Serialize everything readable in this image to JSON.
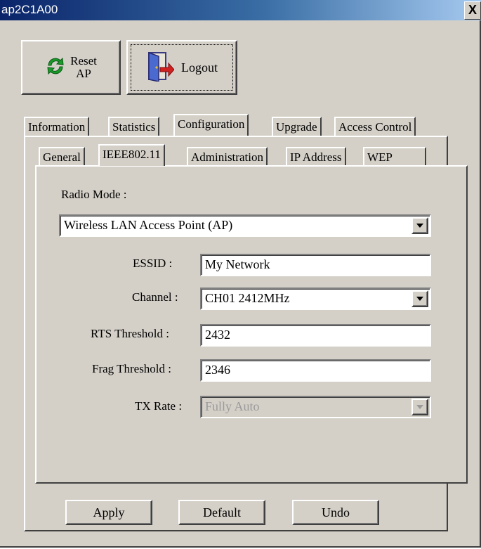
{
  "window": {
    "title": "ap2C1A00",
    "close_symbol": "X"
  },
  "toolbar": {
    "reset_label_line1": "Reset",
    "reset_label_line2": "AP",
    "logout_label": "Logout"
  },
  "main_tabs": [
    {
      "label": "Information"
    },
    {
      "label": "Statistics"
    },
    {
      "label": "Configuration",
      "active": true
    },
    {
      "label": "Upgrade"
    },
    {
      "label": "Access Control"
    }
  ],
  "sub_tabs": [
    {
      "label": "General"
    },
    {
      "label": "IEEE802.11",
      "active": true
    },
    {
      "label": "Administration"
    },
    {
      "label": "IP Address"
    },
    {
      "label": "WEP"
    }
  ],
  "form": {
    "radio_mode_label": "Radio Mode :",
    "radio_mode_value": "Wireless LAN Access Point (AP)",
    "essid_label": "ESSID :",
    "essid_value": "My Network",
    "channel_label": "Channel :",
    "channel_value": "CH01 2412MHz",
    "rts_label": "RTS Threshold :",
    "rts_value": "2432",
    "frag_label": "Frag Threshold :",
    "frag_value": "2346",
    "txrate_label": "TX Rate :",
    "txrate_value": "Fully Auto"
  },
  "buttons": {
    "apply": "Apply",
    "default": "Default",
    "undo": "Undo"
  }
}
